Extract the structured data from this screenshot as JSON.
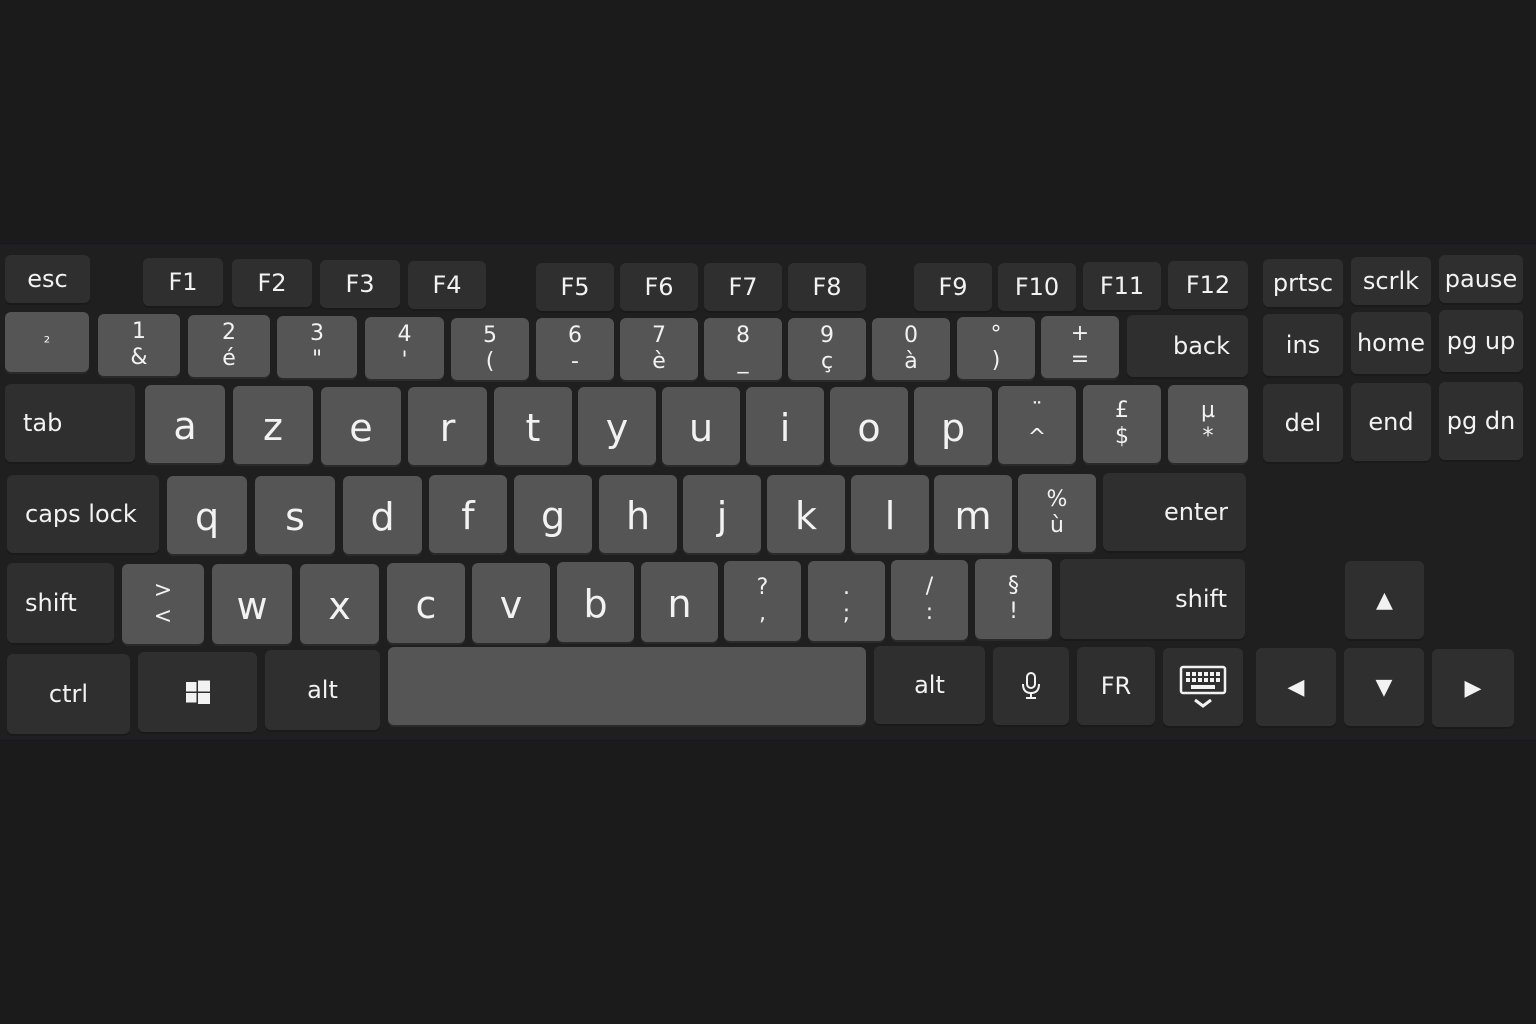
{
  "keyboard": {
    "row_fn": {
      "esc": "esc",
      "f": [
        "F1",
        "F2",
        "F3",
        "F4",
        "F5",
        "F6",
        "F7",
        "F8",
        "F9",
        "F10",
        "F11",
        "F12"
      ],
      "prtsc": "prtsc",
      "scrlk": "scrlk",
      "pause": "pause"
    },
    "row_num": {
      "k1": "²",
      "keys": [
        {
          "top": "1",
          "bottom": "&"
        },
        {
          "top": "2",
          "bottom": "é"
        },
        {
          "top": "3",
          "bottom": "\""
        },
        {
          "top": "4",
          "bottom": "'"
        },
        {
          "top": "5",
          "bottom": "("
        },
        {
          "top": "6",
          "bottom": "-"
        },
        {
          "top": "7",
          "bottom": "è"
        },
        {
          "top": "8",
          "bottom": "_"
        },
        {
          "top": "9",
          "bottom": "ç"
        },
        {
          "top": "0",
          "bottom": "à"
        },
        {
          "top": "°",
          "bottom": ")"
        },
        {
          "top": "+",
          "bottom": "="
        }
      ],
      "back": "back",
      "ins": "ins",
      "home": "home",
      "pgup": "pg up"
    },
    "row_top": {
      "tab": "tab",
      "letters": [
        "a",
        "z",
        "e",
        "r",
        "t",
        "y",
        "u",
        "i",
        "o",
        "p"
      ],
      "sym": [
        {
          "top": "¨",
          "bottom": "^"
        },
        {
          "top": "£",
          "bottom": "$"
        },
        {
          "top": "µ",
          "bottom": "*"
        }
      ],
      "del": "del",
      "end": "end",
      "pgdn": "pg dn"
    },
    "row_home": {
      "caps": "caps lock",
      "letters": [
        "q",
        "s",
        "d",
        "f",
        "g",
        "h",
        "j",
        "k",
        "l",
        "m"
      ],
      "sym": {
        "top": "%",
        "bottom": "ù"
      },
      "enter": "enter"
    },
    "row_bottom": {
      "shift_left": "shift",
      "angle": {
        "top": ">",
        "bottom": "<"
      },
      "letters": [
        "w",
        "x",
        "c",
        "v",
        "b",
        "n"
      ],
      "sym": [
        {
          "top": "?",
          "bottom": ","
        },
        {
          "top": ".",
          "bottom": ";"
        },
        {
          "top": "/",
          "bottom": ":"
        },
        {
          "top": "§",
          "bottom": "!"
        }
      ],
      "shift_right": "shift",
      "up": "▲"
    },
    "row_space": {
      "ctrl": "ctrl",
      "alt_left": "alt",
      "alt_right": "alt",
      "lang": "FR",
      "left": "◀",
      "down": "▼",
      "right": "▶"
    }
  }
}
